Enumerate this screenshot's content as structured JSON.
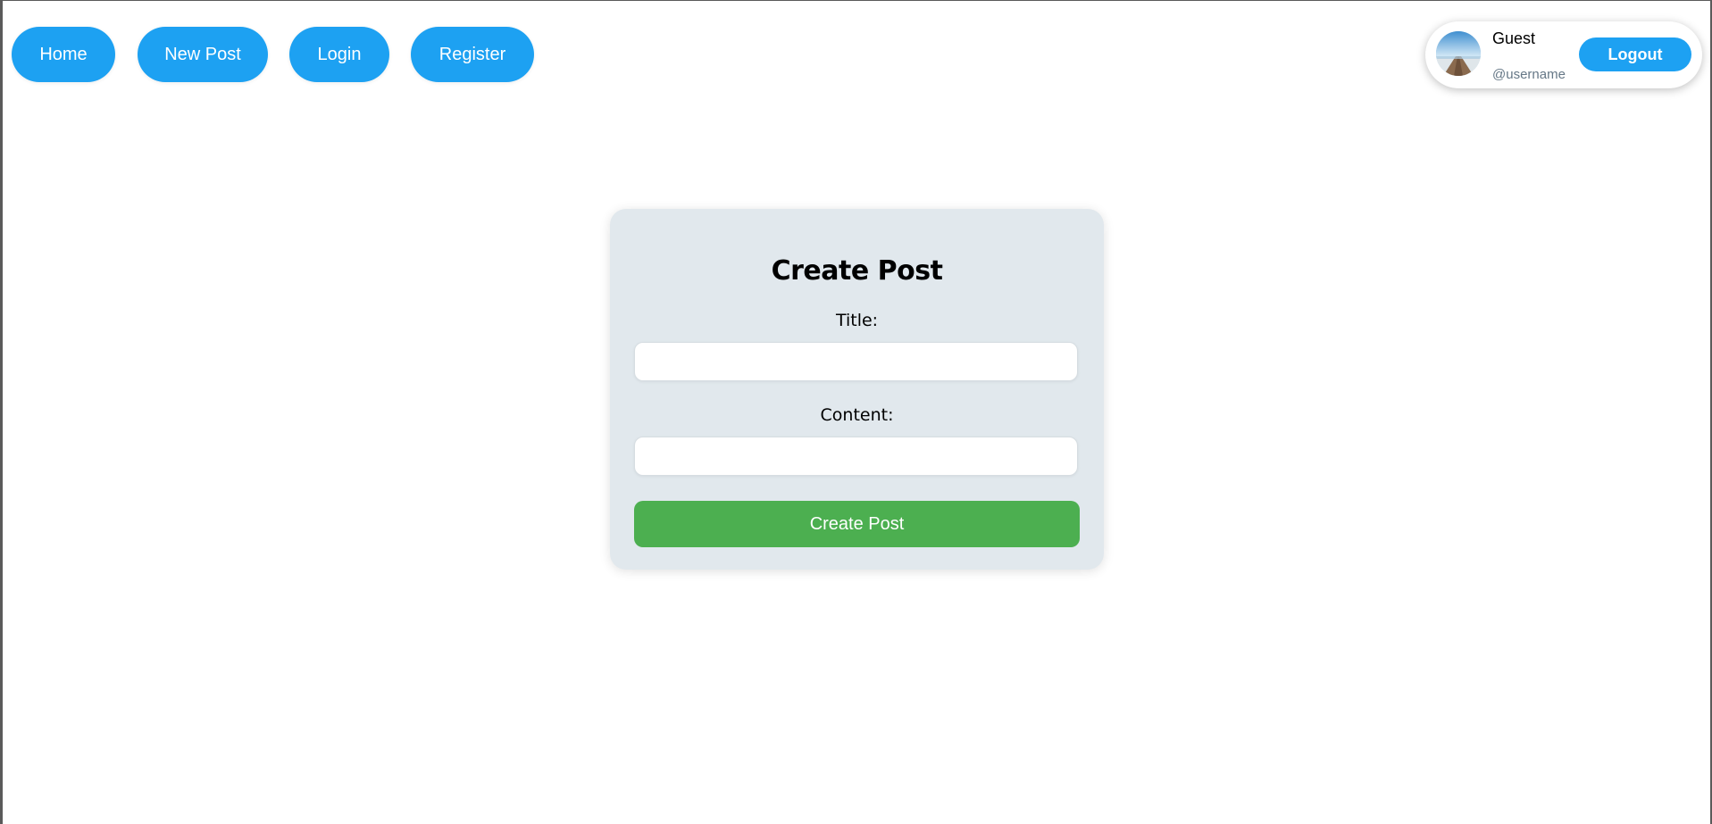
{
  "nav": {
    "home_label": "Home",
    "new_post_label": "New Post",
    "login_label": "Login",
    "register_label": "Register"
  },
  "user": {
    "name": "Guest",
    "handle": "@username",
    "logout_label": "Logout",
    "avatar_icon": "avatar-photo"
  },
  "form": {
    "heading": "Create Post",
    "title_label": "Title:",
    "title_value": "",
    "content_label": "Content:",
    "content_value": "",
    "submit_label": "Create Post"
  },
  "colors": {
    "nav_button": "#1da1f2",
    "submit_button": "#4caf50",
    "card_background": "#e1e8ed",
    "handle_text": "#657786"
  }
}
